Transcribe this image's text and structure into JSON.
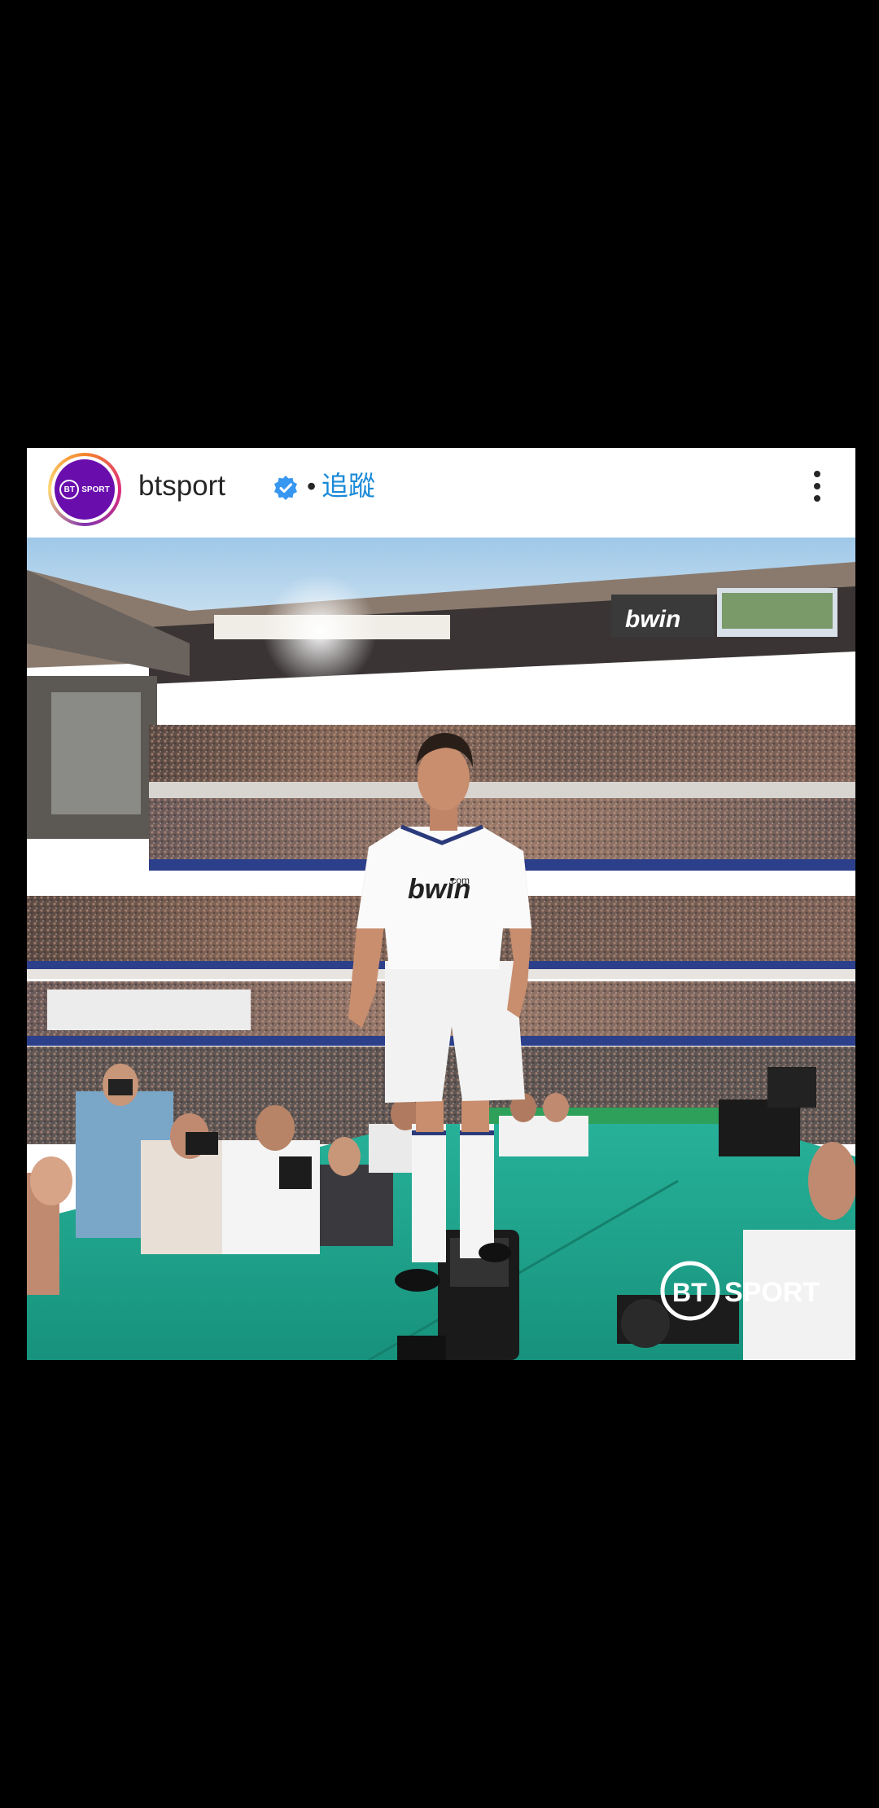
{
  "post": {
    "username": "btsport",
    "separator": "•",
    "follow_label": "追蹤",
    "avatar_logo": {
      "bt": "BT",
      "sport": "SPORT"
    },
    "photo": {
      "jersey_sponsor": "bwin",
      "jersey_sponsor_suffix": ".com",
      "stand_banner": "bwin",
      "watermark_bt": "BT",
      "watermark_sport": "SPORT"
    }
  },
  "colors": {
    "background": "#000000",
    "card": "#ffffff",
    "link": "#1a8ad8",
    "verified": "#3897f0",
    "avatar_bg": "#6a0dad",
    "pitch": "#1fa089"
  },
  "icons": {
    "verified": "verified-badge-icon",
    "more": "more-vertical-icon"
  }
}
